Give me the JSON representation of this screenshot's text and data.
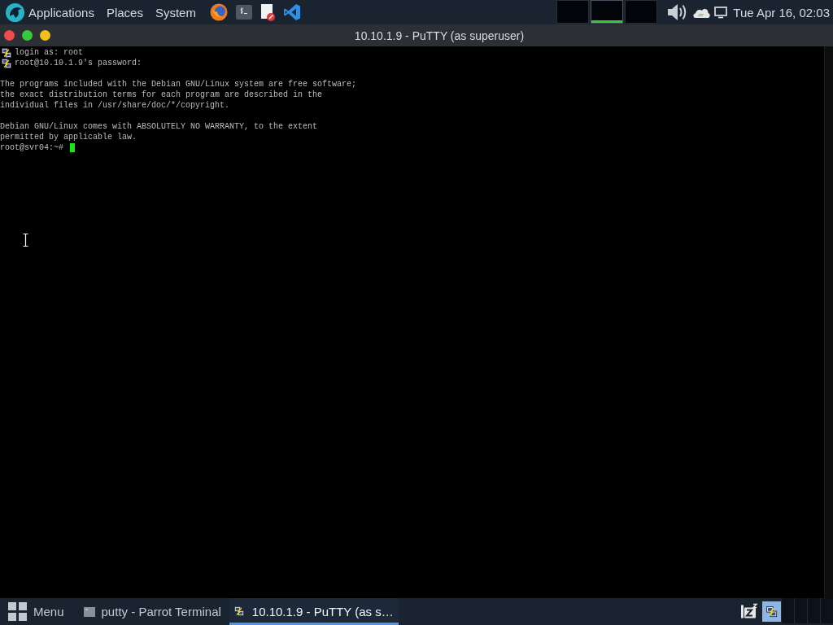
{
  "top_panel": {
    "menus": [
      {
        "label": "Applications"
      },
      {
        "label": "Places"
      },
      {
        "label": "System"
      }
    ],
    "workspaces": [
      {
        "selected": false
      },
      {
        "selected": true
      },
      {
        "selected": false
      }
    ],
    "clock": "Tue Apr 16, 02:03"
  },
  "window": {
    "title": "10.10.1.9 - PuTTY (as superuser)"
  },
  "terminal": {
    "lines": [
      {
        "kind": "event",
        "text": "login as: root"
      },
      {
        "kind": "event",
        "text": "root@10.10.1.9's password:"
      },
      {
        "kind": "blank"
      },
      {
        "kind": "output",
        "text": "The programs included with the Debian GNU/Linux system are free software;"
      },
      {
        "kind": "output",
        "text": "the exact distribution terms for each program are described in the"
      },
      {
        "kind": "output",
        "text": "individual files in /usr/share/doc/*/copyright."
      },
      {
        "kind": "blank"
      },
      {
        "kind": "output",
        "text": "Debian GNU/Linux comes with ABSOLUTELY NO WARRANTY, to the extent"
      },
      {
        "kind": "output",
        "text": "permitted by applicable law."
      },
      {
        "kind": "prompt",
        "text": "root@svr04:~#"
      }
    ]
  },
  "taskbar": {
    "menu": "Menu",
    "tasks": [
      {
        "label": "putty - Parrot Terminal",
        "selected": false
      },
      {
        "label": "10.10.1.9 - PuTTY (as s…",
        "selected": true
      }
    ],
    "tray": [
      {
        "selected": false
      },
      {
        "selected": true
      }
    ]
  }
}
